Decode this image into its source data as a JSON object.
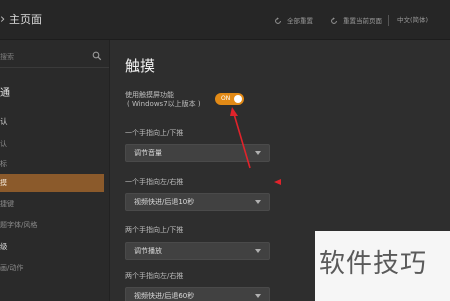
{
  "header": {
    "title": "主页面",
    "actions": [
      {
        "label": "全部重置",
        "icon": "reset-icon"
      },
      {
        "label": "重置当前页面",
        "icon": "reset-page-icon"
      }
    ],
    "language": "中文(简体)"
  },
  "sidebar": {
    "search_placeholder": "搜索",
    "items": [
      {
        "label": "通"
      },
      {
        "label": "认"
      },
      {
        "label": "认"
      },
      {
        "label": "标"
      },
      {
        "label": "摸"
      },
      {
        "label": "捷键"
      },
      {
        "label": "题字体/风格"
      },
      {
        "label": "级"
      },
      {
        "label": "画/动作"
      }
    ]
  },
  "main": {
    "title": "触摸",
    "toggle": {
      "label_line1": "使用触摸屏功能",
      "label_line2": "( Windows7以上版本 )",
      "state": "ON"
    },
    "fields": [
      {
        "label": "一个手指向上/下推",
        "value": "调节音量"
      },
      {
        "label": "一个手指向左/右推",
        "value": "视频快进/后退10秒"
      },
      {
        "label": "两个手指向上/下推",
        "value": "调节播放"
      },
      {
        "label": "两个手指向左/右推",
        "value": "视频快进/后退60秒"
      }
    ]
  },
  "watermark": "软件技巧",
  "colors": {
    "accent": "#e28a16",
    "active_nav": "#8b5a2b",
    "annotation": "#e0232b"
  }
}
